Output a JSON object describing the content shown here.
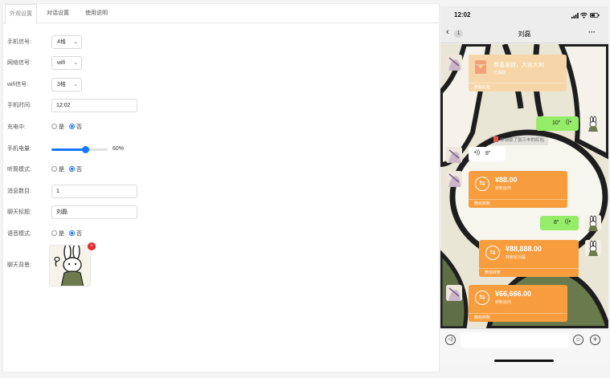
{
  "tabs": [
    {
      "label": "外观设置"
    },
    {
      "label": "对话设置"
    },
    {
      "label": "使用说明"
    }
  ],
  "form": {
    "signal": {
      "label": "手机信号:",
      "value": "4格"
    },
    "network": {
      "label": "网络信号:",
      "value": "wifi"
    },
    "wifi": {
      "label": "wifi信号:",
      "value": "3格"
    },
    "time": {
      "label": "手机时间:",
      "value": "12:02"
    },
    "charging": {
      "label": "充电中:",
      "yes": "是",
      "no": "否",
      "selected": "否"
    },
    "battery": {
      "label": "手机电量:",
      "value": 60,
      "display": "60%"
    },
    "earpiece": {
      "label": "听筒模式:",
      "yes": "是",
      "no": "否",
      "selected": "否"
    },
    "msg_count": {
      "label": "消息数目:",
      "value": "1"
    },
    "chat_title": {
      "label": "聊天标题:",
      "value": "刘磊"
    },
    "voice_mode": {
      "label": "语音模式:",
      "yes": "是",
      "no": "否",
      "selected": "否"
    },
    "chat_bg": {
      "label": "聊天背景:",
      "remove_glyph": "×"
    }
  },
  "phone": {
    "time": "12:02",
    "back_count": "1",
    "title": "刘磊",
    "more": "···",
    "messages": {
      "redpacket": {
        "title": "恭喜发财，大吉大利",
        "sub": "已领取",
        "foot": "微信红包"
      },
      "system": "你领取了张三丰的红包",
      "voice1": {
        "duration": "10\""
      },
      "voice2": {
        "duration": "8\""
      },
      "transfer1": {
        "amount": "¥88.00",
        "sub": "转账给你",
        "foot": "微信转账"
      },
      "voice3": {
        "duration": "8\""
      },
      "transfer2": {
        "amount": "¥88,888.00",
        "sub": "转账给刘磊",
        "foot": "微信转账"
      },
      "transfer3": {
        "amount": "¥66,666.00",
        "sub": "转账给你",
        "foot": "微信转账"
      }
    }
  },
  "colors": {
    "accent": "#1677ff",
    "green_bubble": "#95ec69",
    "transfer_orange": "#f79d3e",
    "badge_red": "#e8272e"
  }
}
